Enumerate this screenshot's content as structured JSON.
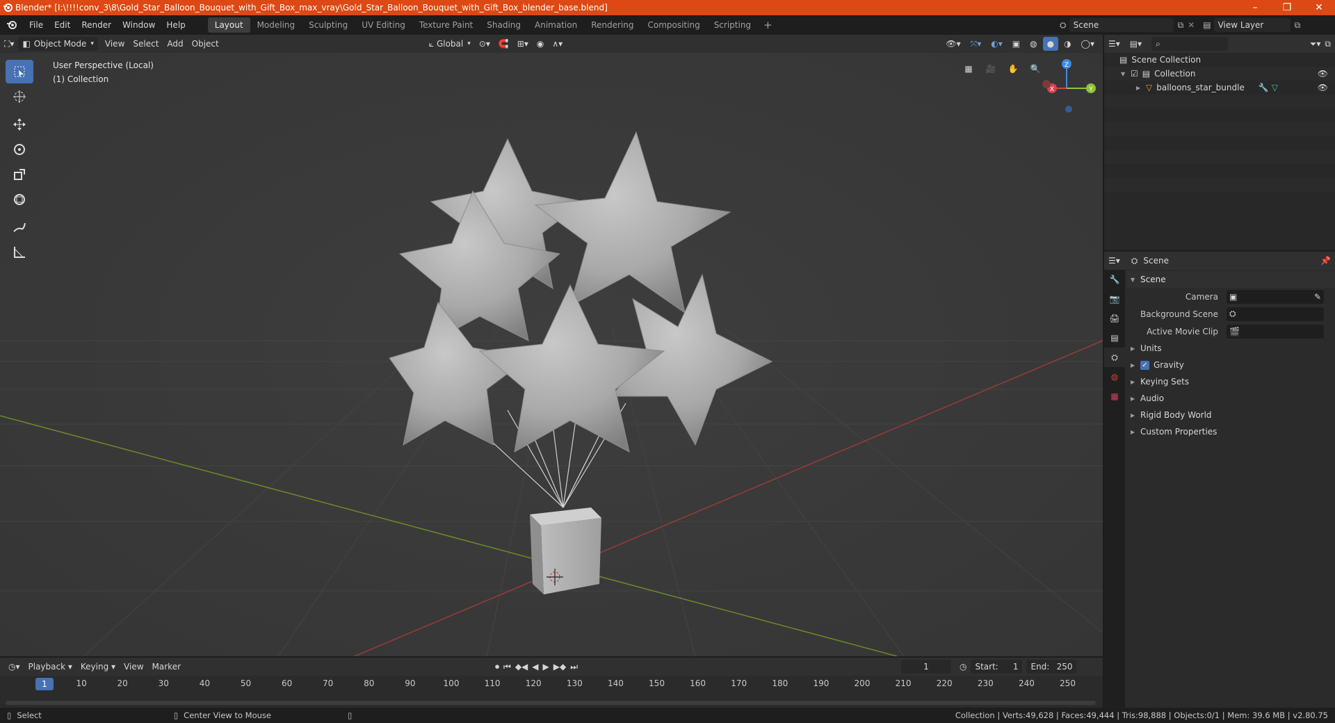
{
  "window": {
    "title": "Blender* [I:\\!!!!conv_3\\8\\Gold_Star_Balloon_Bouquet_with_Gift_Box_max_vray\\Gold_Star_Balloon_Bouquet_with_Gift_Box_blender_base.blend]",
    "controls": [
      "–",
      "❐",
      "✕"
    ]
  },
  "menu": [
    "File",
    "Edit",
    "Render",
    "Window",
    "Help"
  ],
  "workspaces": [
    "Layout",
    "Modeling",
    "Sculpting",
    "UV Editing",
    "Texture Paint",
    "Shading",
    "Animation",
    "Rendering",
    "Compositing",
    "Scripting"
  ],
  "active_workspace": "Layout",
  "workspace_add": "+",
  "scene_selector": {
    "scene": "Scene",
    "view_layer": "View Layer"
  },
  "viewport": {
    "mode": "Object Mode",
    "menus": [
      "View",
      "Select",
      "Add",
      "Object"
    ],
    "transform_orientation": "Global",
    "info_line1": "User Perspective (Local)",
    "info_line2": "(1) Collection",
    "gizmo": {
      "x": "X",
      "y": "Y",
      "z": "Z"
    }
  },
  "outliner": {
    "rows": [
      {
        "label": "Scene Collection"
      },
      {
        "label": "Collection"
      },
      {
        "label": "balloons_star_bundle"
      }
    ]
  },
  "properties": {
    "header_title": "Scene",
    "panel_title": "Scene",
    "fields": [
      {
        "label": "Camera",
        "value": ""
      },
      {
        "label": "Background Scene",
        "value": ""
      },
      {
        "label": "Active Movie Clip",
        "value": ""
      }
    ],
    "subpanels": [
      "Units",
      "Gravity",
      "Keying Sets",
      "Audio",
      "Rigid Body World",
      "Custom Properties"
    ],
    "gravity_checked": true
  },
  "timeline": {
    "menus": [
      "Playback",
      "Keying",
      "View",
      "Marker"
    ],
    "current_frame": "1",
    "start_label": "Start:",
    "start": "1",
    "end_label": "End:",
    "end": "250",
    "ruler": [
      "1",
      "10",
      "20",
      "30",
      "40",
      "50",
      "60",
      "70",
      "80",
      "90",
      "100",
      "110",
      "120",
      "130",
      "140",
      "150",
      "160",
      "170",
      "180",
      "190",
      "200",
      "210",
      "220",
      "230",
      "240",
      "250"
    ]
  },
  "status": {
    "select": "Select",
    "center_view": "Center View to Mouse",
    "stats": "Collection | Verts:49,628 | Faces:49,444 | Tris:98,888 | Objects:0/1 | Mem: 39.6 MB | v2.80.75"
  },
  "colors": {
    "title_bar": "#dd4814",
    "accent": "#4772b3",
    "x_axis": "#d8424e",
    "y_axis": "#8cc43a",
    "z_axis": "#3f8ae0"
  }
}
